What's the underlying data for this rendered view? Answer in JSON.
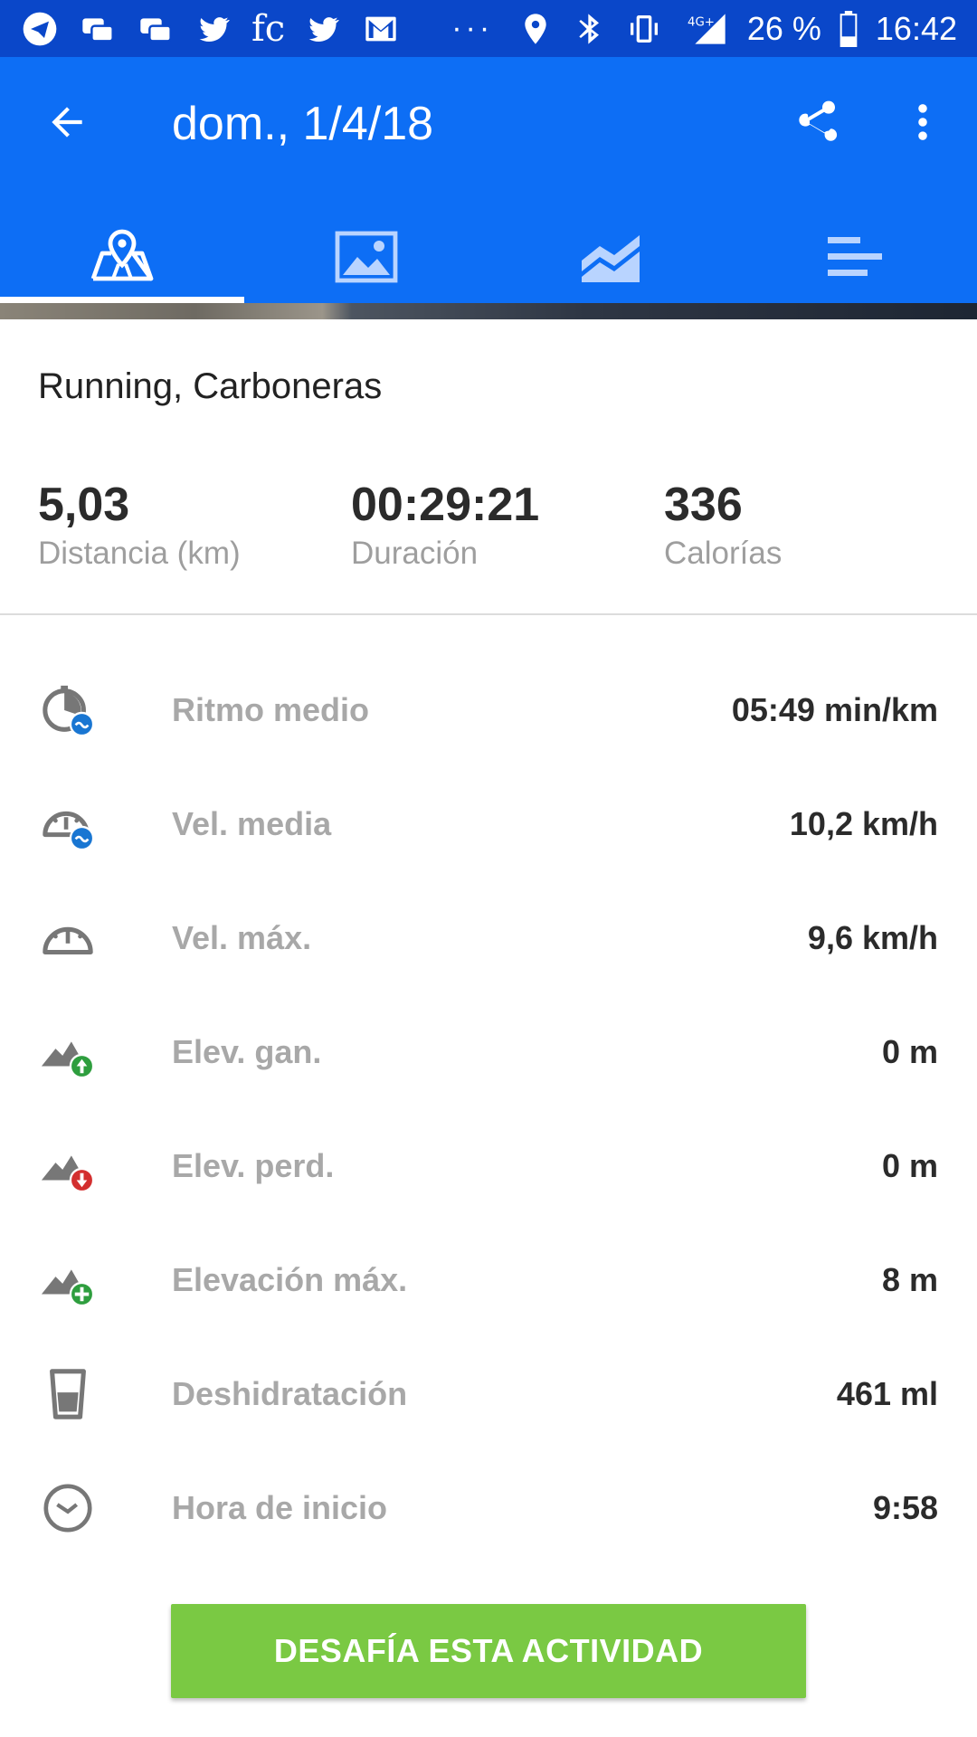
{
  "status_bar": {
    "battery": "26 %",
    "time": "16:42",
    "network": "4G+",
    "more": "···",
    "fc_label": "fc"
  },
  "app_bar": {
    "title": "dom., 1/4/18",
    "back_icon": "arrow-back-icon",
    "share_icon": "share-icon",
    "more_icon": "more-vert-icon",
    "color": "#0d6ef5"
  },
  "tabs": [
    {
      "icon": "map-icon",
      "active": true
    },
    {
      "icon": "photo-icon",
      "active": false
    },
    {
      "icon": "chart-icon",
      "active": false
    },
    {
      "icon": "list-icon",
      "active": false
    }
  ],
  "activity": {
    "name": "Running, Carboneras"
  },
  "stats": [
    {
      "value": "5,03",
      "label": "Distancia (km)"
    },
    {
      "value": "00:29:21",
      "label": "Duración"
    },
    {
      "value": "336",
      "label": "Calorías"
    }
  ],
  "metrics": [
    {
      "icon": "avg-pace-icon",
      "label": "Ritmo medio",
      "value": "05:49 min/km"
    },
    {
      "icon": "avg-speed-icon",
      "label": "Vel. media",
      "value": "10,2 km/h"
    },
    {
      "icon": "max-speed-icon",
      "label": "Vel. máx.",
      "value": "9,6 km/h"
    },
    {
      "icon": "elevation-gain-icon",
      "label": "Elev. gan.",
      "value": "0 m"
    },
    {
      "icon": "elevation-loss-icon",
      "label": "Elev. perd.",
      "value": "0 m"
    },
    {
      "icon": "elevation-max-icon",
      "label": "Elevación máx.",
      "value": "8 m"
    },
    {
      "icon": "dehydration-icon",
      "label": "Deshidratación",
      "value": "461 ml"
    },
    {
      "icon": "start-time-icon",
      "label": "Hora de inicio",
      "value": "9:58"
    }
  ],
  "challenge_button": {
    "label": "DESAFÍA ESTA ACTIVIDAD",
    "color": "#7ac943"
  }
}
